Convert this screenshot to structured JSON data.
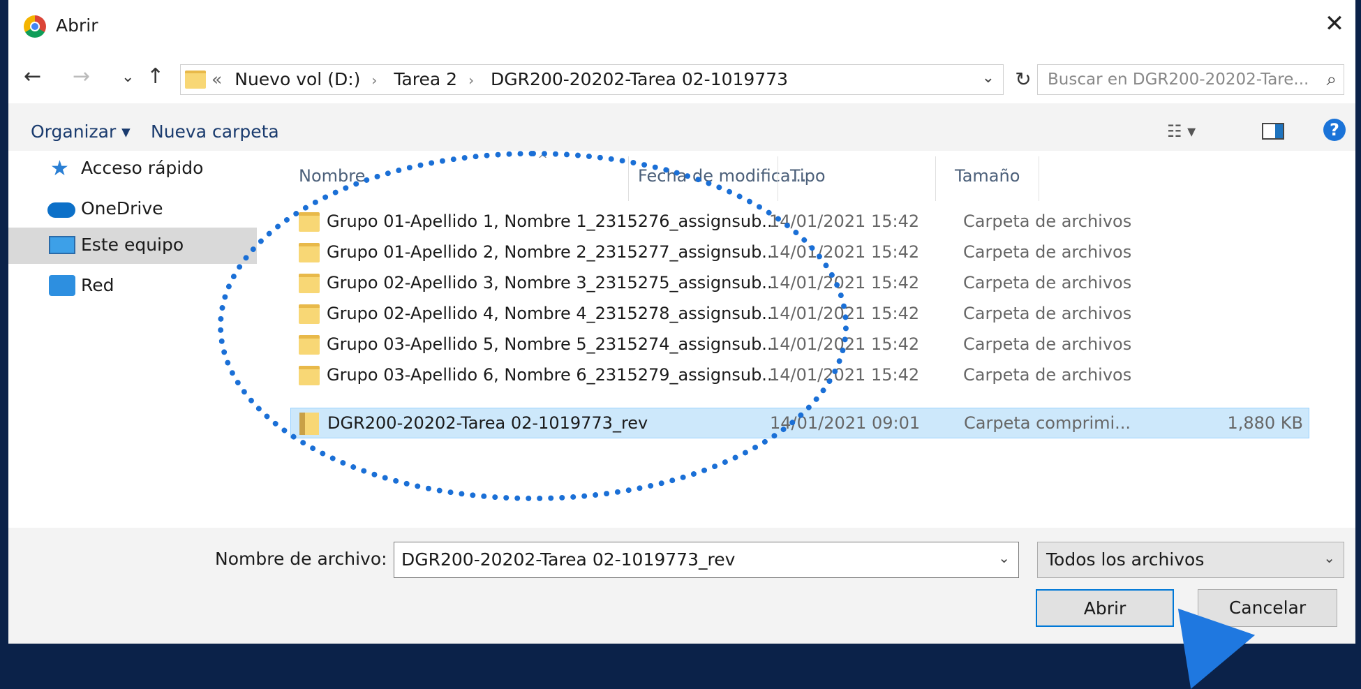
{
  "window": {
    "title": "Abrir",
    "close_glyph": "✕"
  },
  "nav": {
    "back_glyph": "←",
    "forward_glyph": "→",
    "recent_glyph": "⌄",
    "up_glyph": "↑",
    "address": {
      "overflow": "«",
      "crumbs": [
        "Nuevo vol (D:)",
        "Tarea 2",
        "DGR200-20202-Tarea 02-1019773"
      ],
      "sep": "›",
      "dropdown_glyph": "⌄"
    },
    "refresh_glyph": "↻",
    "search": {
      "placeholder": "Buscar en DGR200-20202-Tare...",
      "icon": "search-icon"
    }
  },
  "toolbar": {
    "organize": "Organizar ▾",
    "new_folder": "Nueva carpeta",
    "view_glyph": "☷ ▾",
    "help_glyph": "?"
  },
  "sidebar": {
    "items": [
      {
        "label": "Acceso rápido",
        "icon": "star-icon"
      },
      {
        "label": "OneDrive",
        "icon": "cloud-icon"
      },
      {
        "label": "Este equipo",
        "icon": "computer-icon",
        "selected": true
      },
      {
        "label": "Red",
        "icon": "network-icon"
      }
    ]
  },
  "columns": {
    "sort_glyph": "^",
    "name": "Nombre",
    "date": "Fecha de modifica...",
    "type": "Tipo",
    "size": "Tamaño"
  },
  "rows": [
    {
      "name": "Grupo 01-Apellido 1, Nombre 1_2315276_assignsub...",
      "date": "14/01/2021 15:42",
      "type": "Carpeta de archivos",
      "size": ""
    },
    {
      "name": "Grupo 01-Apellido 2, Nombre 2_2315277_assignsub...",
      "date": "14/01/2021 15:42",
      "type": "Carpeta de archivos",
      "size": ""
    },
    {
      "name": "Grupo 02-Apellido 3, Nombre 3_2315275_assignsub...",
      "date": "14/01/2021 15:42",
      "type": "Carpeta de archivos",
      "size": ""
    },
    {
      "name": "Grupo 02-Apellido 4, Nombre 4_2315278_assignsub...",
      "date": "14/01/2021 15:42",
      "type": "Carpeta de archivos",
      "size": ""
    },
    {
      "name": "Grupo 03-Apellido 5, Nombre 5_2315274_assignsub...",
      "date": "14/01/2021 15:42",
      "type": "Carpeta de archivos",
      "size": ""
    },
    {
      "name": "Grupo 03-Apellido 6, Nombre 6_2315279_assignsub...",
      "date": "14/01/2021 15:42",
      "type": "Carpeta de archivos",
      "size": ""
    },
    {
      "name": "DGR200-20202-Tarea 02-1019773_rev",
      "date": "14/01/2021 09:01",
      "type": "Carpeta comprimi...",
      "size": "1,880 KB",
      "selected": true
    }
  ],
  "footer": {
    "filename_label": "Nombre de archivo:",
    "filename_value": "DGR200-20202-Tarea 02-1019773_rev",
    "filter_value": "Todos los archivos",
    "dropdown_glyph": "⌄",
    "open_button": "Abrir",
    "cancel_button": "Cancelar"
  },
  "colors": {
    "annotation": "#1a6fd6",
    "selection": "#cde8fb",
    "background": "#0b2249"
  }
}
